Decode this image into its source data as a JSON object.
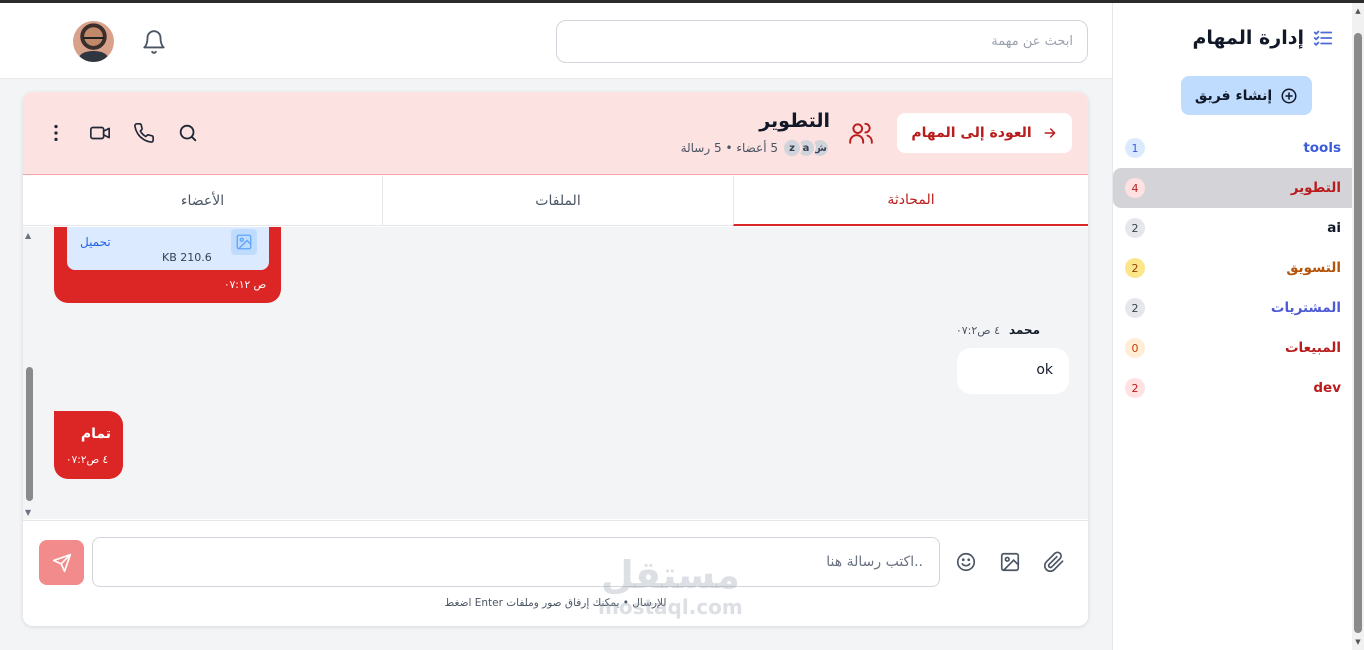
{
  "app": {
    "title": "إدارة المهام",
    "create_team_label": "إنشاء فريق"
  },
  "sidebar": {
    "teams": [
      {
        "name": "tools",
        "count": "1",
        "color": "#3b5bdb",
        "badge_bg": "#dbeafe",
        "badge_fg": "#3b5bdb"
      },
      {
        "name": "التطوير",
        "count": "4",
        "color": "#b91c1c",
        "badge_bg": "#fee2e2",
        "badge_fg": "#b91c1c"
      },
      {
        "name": "ai",
        "count": "2",
        "color": "#111827",
        "badge_bg": "#e5e7eb",
        "badge_fg": "#374151"
      },
      {
        "name": "التسويق",
        "count": "2",
        "color": "#b45309",
        "badge_bg": "#fde68a",
        "badge_fg": "#92400e"
      },
      {
        "name": "المشتريات",
        "count": "2",
        "color": "#4f5bd5",
        "badge_bg": "#e5e7eb",
        "badge_fg": "#374151"
      },
      {
        "name": "المبيعات",
        "count": "0",
        "color": "#b91c1c",
        "badge_bg": "#ffedd5",
        "badge_fg": "#c2410c"
      },
      {
        "name": "dev",
        "count": "2",
        "color": "#b91c1c",
        "badge_bg": "#fee2e2",
        "badge_fg": "#b91c1c"
      }
    ]
  },
  "header": {
    "search_placeholder": "ابحث عن مهمة"
  },
  "channel": {
    "back_label": "العودة إلى المهام",
    "title": "التطوير",
    "avatars": [
      "z",
      "a",
      "ش"
    ],
    "meta": "5 أعضاء • 5 رسالة"
  },
  "tabs": [
    "المحادثة",
    "الملفات",
    "الأعضاء"
  ],
  "messages": {
    "file": {
      "download_label": "تحميل",
      "size": "KB 210.6",
      "time": "۰۷:۱۲ ص"
    },
    "incoming": {
      "sender": "محمد",
      "time": "۰۷:۲٤ ص",
      "text": "ok"
    },
    "outgoing": {
      "text": "تمام",
      "time": "۰۷:۲٤ ص"
    }
  },
  "composer": {
    "placeholder": "..اكتب رسالة هنا",
    "hint": "اضغط Enter للإرسال • يمكنك إرفاق صور وملفات"
  },
  "watermark": {
    "line1": "مستقل",
    "line2": "mostaql.com"
  },
  "colors": {
    "accent": "#dc2626",
    "header_bg": "#fde2e2",
    "primary_soft": "#bfdbfe"
  }
}
